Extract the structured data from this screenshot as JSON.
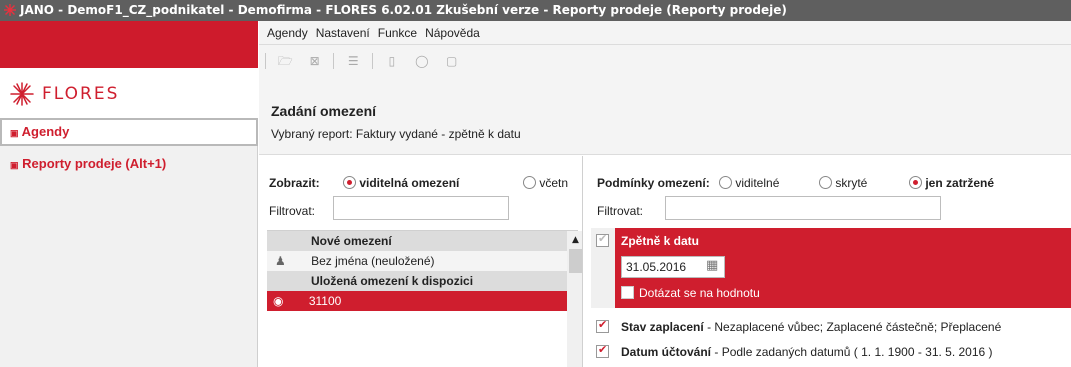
{
  "window": {
    "title": "JANO - DemoF1_CZ_podnikatel - Demofirma - FLORES 6.02.01 Zkušební verze - Reporty prodeje  (Reporty prodeje)"
  },
  "sidebar": {
    "logo_text": "FLORES",
    "items": [
      {
        "label": "Agendy"
      },
      {
        "label": "Reporty prodeje (Alt+1)"
      }
    ]
  },
  "menubar": {
    "items": [
      {
        "label": "Agendy"
      },
      {
        "label": "Nastavení"
      },
      {
        "label": "Funkce"
      },
      {
        "label": "Nápověda"
      }
    ]
  },
  "header": {
    "title": "Zadání omezení",
    "subtitle": "Vybraný report: Faktury vydané - zpětně k datu"
  },
  "left_panel": {
    "show_label": "Zobrazit:",
    "options": [
      "viditelná omezení",
      "včetn"
    ],
    "selected": "viditelná omezení",
    "filter_label": "Filtrovat:",
    "filter_value": "",
    "list": [
      {
        "type": "header",
        "label": "Nové omezení"
      },
      {
        "type": "item",
        "label": "Bez jména (neuložené)"
      },
      {
        "type": "header",
        "label": "Uložená omezení k dispozici"
      },
      {
        "type": "item",
        "label": "31100",
        "selected": true
      }
    ]
  },
  "right_panel": {
    "conditions_label": "Podmínky omezení:",
    "options": [
      "viditelné",
      "skryté",
      "jen zatržené"
    ],
    "selected": "jen zatržené",
    "filter_label": "Filtrovat:",
    "filter_value": "",
    "conditions": [
      {
        "name": "Zpětně k datu",
        "date": "31.05.2016",
        "ask_label": "Dotázat se na hodnotu",
        "highlighted": true
      },
      {
        "name": "Stav zaplacení",
        "detail": "- Nezaplacené vůbec; Zaplacené částečně; Přeplacené"
      },
      {
        "name": "Datum účtování",
        "detail": "- Podle zadaných datumů ( 1. 1. 1900 - 31. 5. 2016 )"
      }
    ]
  },
  "colors": {
    "accent": "#cf1e2e",
    "titlebar": "#5f5f5f"
  }
}
